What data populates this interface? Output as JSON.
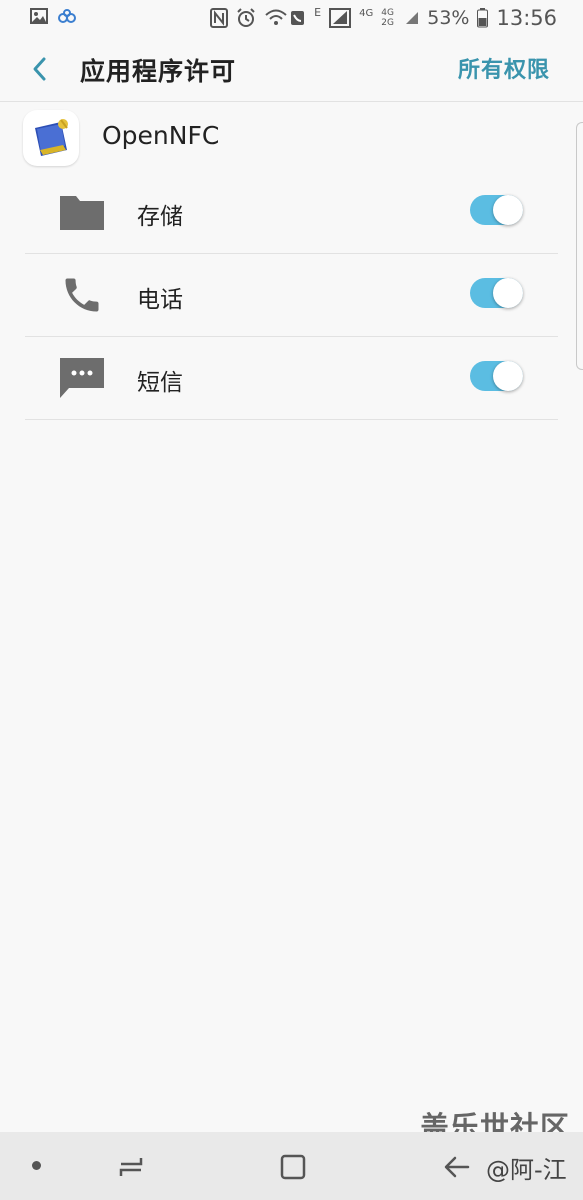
{
  "status_bar": {
    "battery": "53%",
    "time": "13:56",
    "signal_1_label": "4G",
    "signal_2_label": "4G 2G",
    "data_label": "E",
    "left_icons": [
      "gallery-icon",
      "app-notification-icon"
    ],
    "right_icons": [
      "nfc-icon",
      "alarm-icon",
      "wifi-call-icon",
      "signal-icon",
      "battery-icon"
    ]
  },
  "header": {
    "back_icon": "back-chevron-icon",
    "title": "应用程序许可",
    "all_permissions": "所有权限"
  },
  "app": {
    "name": "OpenNFC",
    "icon": "opennfc-app-icon"
  },
  "permissions": [
    {
      "label": "存储",
      "icon": "folder-icon",
      "enabled": true
    },
    {
      "label": "电话",
      "icon": "phone-icon",
      "enabled": true
    },
    {
      "label": "短信",
      "icon": "message-icon",
      "enabled": true
    }
  ],
  "watermark": "盖乐世社区",
  "nav_bar": {
    "credit": "@阿-江",
    "buttons": [
      "dot-icon",
      "recent-apps-icon",
      "home-icon",
      "back-arrow-icon"
    ]
  },
  "colors": {
    "accent": "#3a94ad",
    "toggle_on": "#5bbde2",
    "icon_gray": "#6d6d6d",
    "background": "#f8f8f8"
  }
}
